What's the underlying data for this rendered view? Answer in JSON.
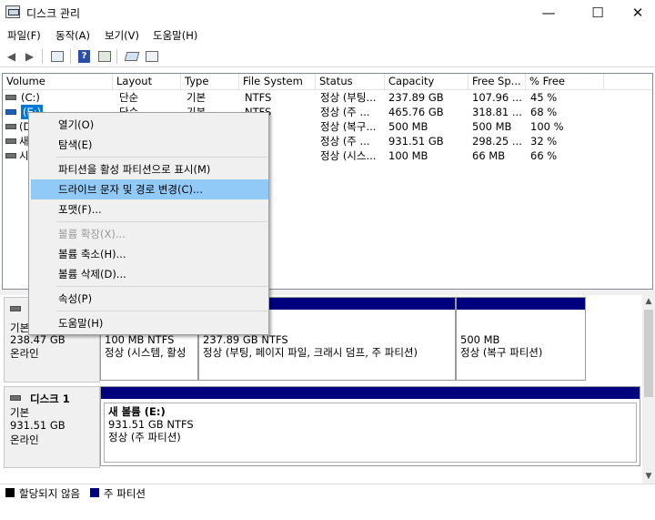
{
  "window": {
    "title": "디스크 관리",
    "minimize": "—",
    "maximize": "☐",
    "close": "✕"
  },
  "menu": [
    {
      "label": "파일(F)"
    },
    {
      "label": "동작(A)"
    },
    {
      "label": "보기(V)"
    },
    {
      "label": "도움말(H)"
    }
  ],
  "toolbar": [
    "back-icon",
    "forward-icon",
    "console-tree-icon",
    "help-icon",
    "properties-icon",
    "connect-icon",
    "refresh-icon"
  ],
  "columns": [
    "Volume",
    "Layout",
    "Type",
    "File System",
    "Status",
    "Capacity",
    "Free Sp...",
    "% Free"
  ],
  "rows": [
    {
      "volume": "(C:)",
      "layout": "단순",
      "type": "기본",
      "fs": "NTFS",
      "status": "정상 (부팅...",
      "capacity": "237.89 GB",
      "free": "107.96 ...",
      "pct": "45 %"
    },
    {
      "volume": "(E:)",
      "layout": "단순",
      "type": "기본",
      "fs": "NTFS",
      "status": "정상 (주 ...",
      "capacity": "465.76 GB",
      "free": "318.81 ...",
      "pct": "68 %"
    },
    {
      "volume": "(D",
      "layout": "",
      "type": "",
      "fs": "",
      "status": "정상 (복구...",
      "capacity": "500 MB",
      "free": "500 MB",
      "pct": "100 %"
    },
    {
      "volume": "새",
      "layout": "",
      "type": "",
      "fs": "",
      "status": "정상 (주 ...",
      "capacity": "931.51 GB",
      "free": "298.25 ...",
      "pct": "32 %"
    },
    {
      "volume": "시",
      "layout": "",
      "type": "",
      "fs": "",
      "status": "정상 (시스...",
      "capacity": "100 MB",
      "free": "66 MB",
      "pct": "66 %"
    }
  ],
  "disk0": {
    "type": "기본",
    "size": "238.47 GB",
    "state": "온라인",
    "partitions": [
      {
        "size": "100 MB NTFS",
        "status": "정상 (시스템, 활성"
      },
      {
        "size": "237.89 GB NTFS",
        "status": "정상 (부팅, 페이지 파일, 크래시 덤프, 주 파티션)"
      },
      {
        "size": "500 MB",
        "status": "정상 (복구 파티션)"
      }
    ]
  },
  "disk1": {
    "name": "디스크 1",
    "type": "기본",
    "size": "931.51 GB",
    "state": "온라인",
    "partition": {
      "name": "새 볼륨  (E:)",
      "size": "931.51 GB NTFS",
      "status": "정상 (주 파티션)"
    }
  },
  "legend": {
    "unallocated": "할당되지 않음",
    "primary": "주 파티션",
    "colors": {
      "unallocated": "#000000",
      "primary": "#00007f"
    }
  },
  "context_menu": {
    "open": "열기(O)",
    "explore": "탐색(E)",
    "mark_active": "파티션을 활성 파티션으로 표시(M)",
    "change_letter": "드라이브 문자 및 경로 변경(C)...",
    "format": "포맷(F)...",
    "extend": "볼륨 확장(X)...",
    "shrink": "볼륨 축소(H)...",
    "delete": "볼륨 삭제(D)...",
    "properties": "속성(P)",
    "help": "도움말(H)"
  }
}
